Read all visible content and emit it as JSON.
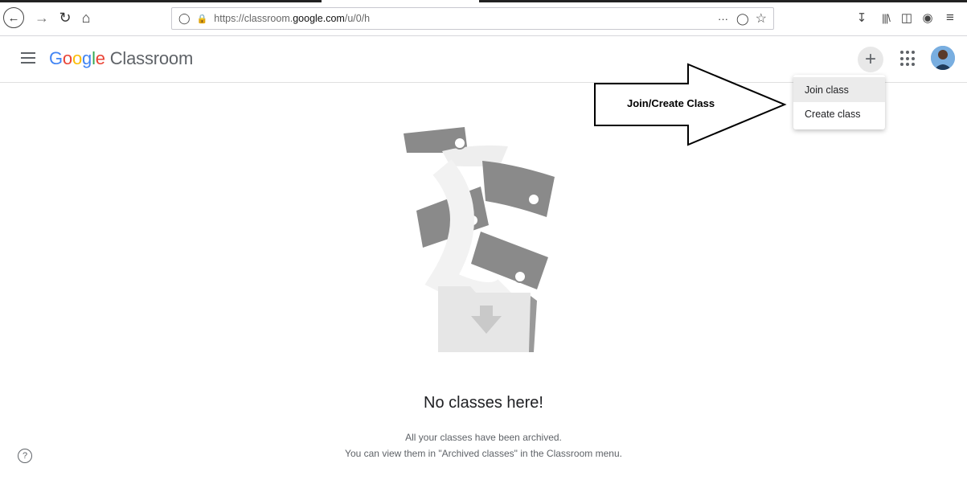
{
  "browser": {
    "url_prefix": "https://classroom.",
    "url_domain": "google.com",
    "url_suffix": "/u/0/h",
    "more_label": "···"
  },
  "app": {
    "logo_google": [
      "G",
      "o",
      "o",
      "g",
      "l",
      "e"
    ],
    "logo_product": "Classroom"
  },
  "header": {
    "plus_label": "+"
  },
  "menu": {
    "items": [
      {
        "label": "Join class"
      },
      {
        "label": "Create class"
      }
    ]
  },
  "annotation": {
    "label": "Join/Create Class"
  },
  "empty_state": {
    "title": "No classes here!",
    "line1": "All your classes have been archived.",
    "line2": "You can view them in \"Archived classes\" in the Classroom menu."
  },
  "footer": {
    "help_label": "?"
  },
  "icons": {
    "back": "back-arrow-icon",
    "forward": "forward-arrow-icon",
    "reload": "reload-icon",
    "home": "home-icon",
    "shield": "tracking-shield-icon",
    "lock": "lock-icon",
    "pocket": "pocket-icon",
    "star": "bookmark-star-icon",
    "download": "download-icon",
    "library": "library-icon",
    "sidebar": "sidebar-icon",
    "account": "account-icon",
    "menu": "hamburger-menu-icon"
  }
}
